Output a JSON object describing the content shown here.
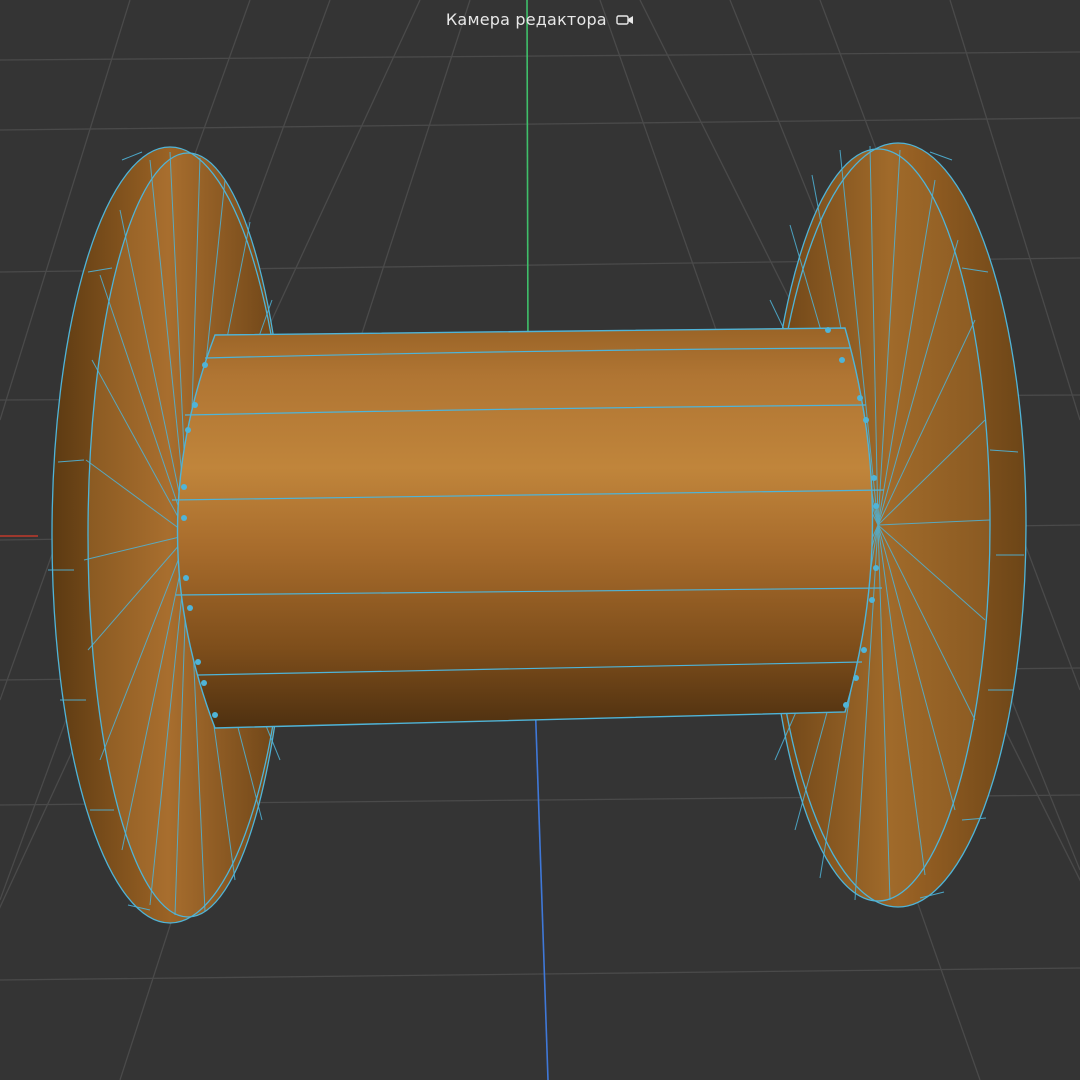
{
  "viewport": {
    "camera_label": "Камера редактора",
    "camera_icon": "video-camera-icon",
    "colors": {
      "background": "#343434",
      "grid": "#4a4a4a",
      "axis_y": "#3fbf6a",
      "axis_z": "#3f78d8",
      "axis_x": "#c0392b",
      "wood_dark": "#5a3a14",
      "wood_mid": "#8f5c22",
      "wood_light": "#b77a33",
      "wireframe": "#4fb4d8"
    }
  },
  "object": {
    "name_icon": "cable-spool-mesh"
  }
}
